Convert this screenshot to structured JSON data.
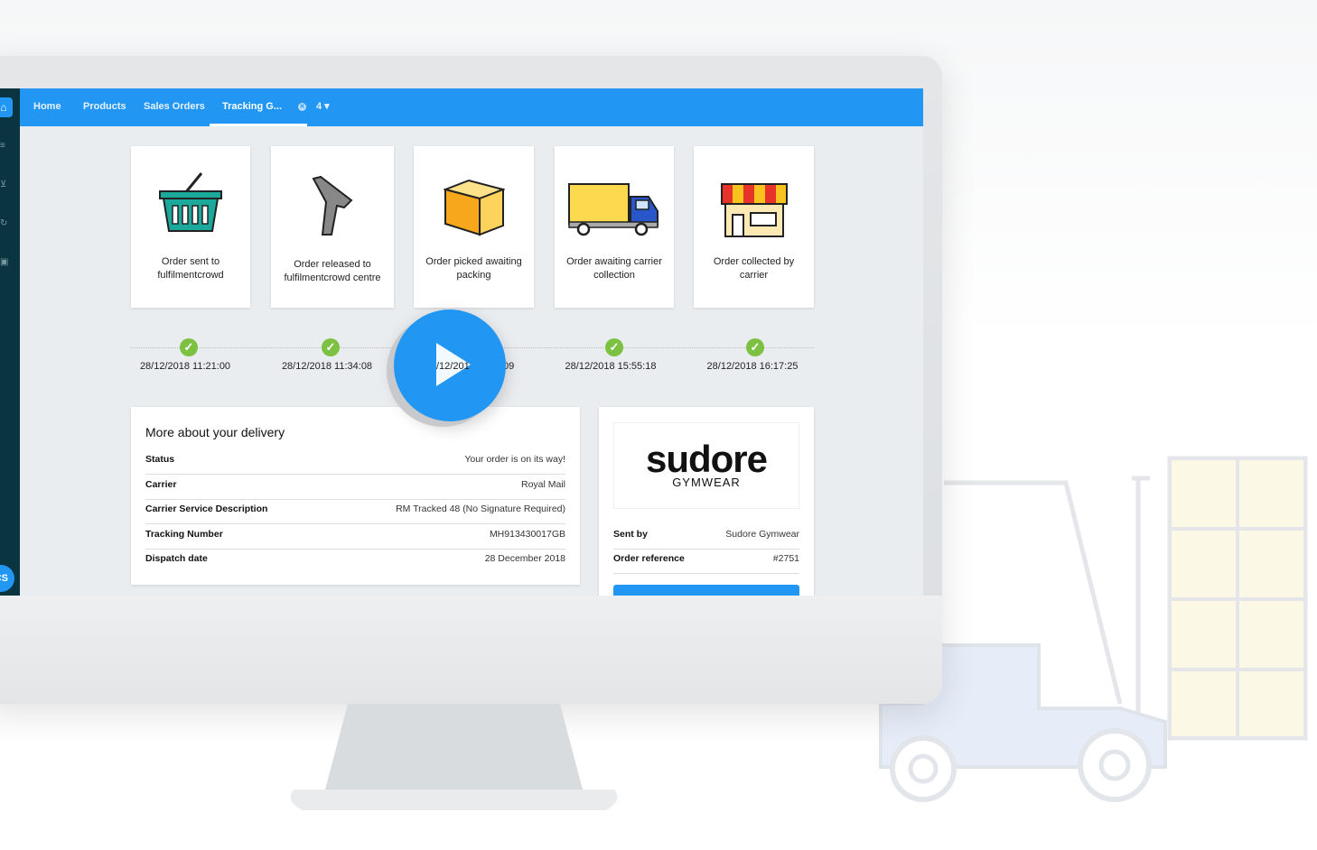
{
  "nav": {
    "tabs": [
      {
        "label": "Home"
      },
      {
        "label": "Products"
      },
      {
        "label": "Sales Orders"
      },
      {
        "label": "Tracking G..."
      },
      {
        "label": "4 ▾"
      }
    ],
    "fab_label": "CS"
  },
  "stages": [
    {
      "label": "Order sent to fulfilmentcrowd",
      "icon": "basket-icon",
      "time": "28/12/2018 11:21:00"
    },
    {
      "label": "Order released to fulfilmentcrowd centre",
      "icon": "scanner-icon",
      "time": "28/12/2018 11:34:08"
    },
    {
      "label": "Order picked awaiting packing",
      "icon": "box-icon",
      "time_fragment_left": "/12/201",
      "time_fragment_right": "09"
    },
    {
      "label": "Order awaiting carrier collection",
      "icon": "truck-icon",
      "time": "28/12/2018 15:55:18"
    },
    {
      "label": "Order collected by carrier",
      "icon": "store-icon",
      "time": "28/12/2018 16:17:25"
    }
  ],
  "delivery": {
    "title": "More about your delivery",
    "rows": [
      {
        "k": "Status",
        "v": "Your order is on its way!"
      },
      {
        "k": "Carrier",
        "v": "Royal Mail"
      },
      {
        "k": "Carrier Service Description",
        "v": "RM Tracked 48 (No Signature Required)"
      },
      {
        "k": "Tracking Number",
        "v": "MH913430017GB"
      },
      {
        "k": "Dispatch date",
        "v": "28 December 2018"
      }
    ]
  },
  "sender": {
    "logo_main": "sudore",
    "logo_sub": "GYMWEAR",
    "rows": [
      {
        "k": "Sent by",
        "v": "Sudore Gymwear"
      },
      {
        "k": "Order reference",
        "v": "#2751"
      }
    ]
  },
  "colors": {
    "accent": "#2196f3",
    "sidebar": "#0a3440",
    "success": "#7cc142"
  }
}
